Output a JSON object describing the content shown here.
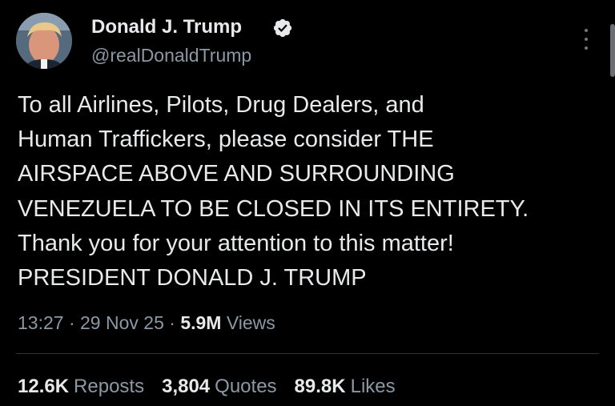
{
  "author": {
    "display_name": "Donald J. Trump",
    "handle": "@realDonaldTrump",
    "verified": true,
    "avatar_icon": "profile-photo",
    "verified_icon": "verified-badge-icon"
  },
  "tweet": {
    "lines": [
      "To all Airlines, Pilots, Drug Dealers, and",
      "Human Traffickers, please consider THE",
      "AIRSPACE ABOVE AND SURROUNDING",
      "VENEZUELA TO BE CLOSED IN ITS ENTIRETY.",
      "Thank you for your attention to this matter!",
      "PRESIDENT DONALD J. TRUMP"
    ],
    "time": "13:27",
    "separator": "·",
    "date": "29 Nov 25",
    "views_count": "5.9M",
    "views_label": "Views"
  },
  "stats": [
    {
      "value": "12.6K",
      "label": "Reposts"
    },
    {
      "value": "3,804",
      "label": "Quotes"
    },
    {
      "value": "89.8K",
      "label": "Likes"
    }
  ],
  "colors": {
    "background": "#000000",
    "text_primary": "#e7e9ea",
    "text_secondary": "#8b98a5",
    "divider": "#2f3336",
    "verified_badge": "#e7e9ea"
  }
}
